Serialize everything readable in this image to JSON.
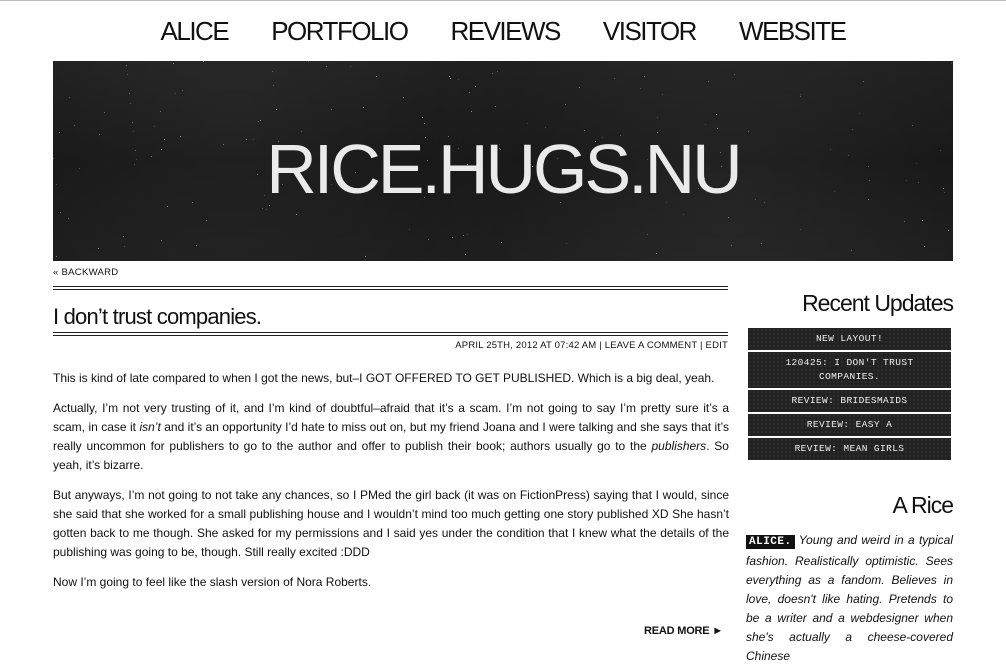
{
  "nav": {
    "items": [
      "ALICE",
      "PORTFOLIO",
      "REVIEWS",
      "VISITOR",
      "WEBSITE"
    ]
  },
  "banner": {
    "title": "RICE.HUGS.NU"
  },
  "backward_label": "« BACKWARD",
  "post": {
    "title": "I don’t trust companies.",
    "date": "APRIL 25TH, 2012 AT 07:42 AM",
    "comment_link": "LEAVE A COMMENT",
    "edit_link": "EDIT",
    "paragraphs": {
      "p1": "This is kind of late compared to when I got the news, but–I GOT OFFERED TO GET PUBLISHED. Which is a big deal, yeah.",
      "p2a": "Actually, I’m not very trusting of it, and I’m kind of doubtful–afraid that it’s a scam. I’m not going to say I’m pretty sure it’s a scam, in case it ",
      "p2b": "isn’t",
      "p2c": " and it’s an opportunity I’d hate to miss out on, but my friend Joana and I were talking and she says that it’s really uncommon for publishers to go to the author and offer to publish their book; authors usually go to the ",
      "p2d": "publishers",
      "p2e": ". So yeah, it’s bizarre.",
      "p3": "But anyways, I’m not going to not take any chances, so I PMed the girl back (it was on FictionPress) saying that I would, since she said that she worked for a small publishing house and I wouldn’t mind too much getting one story published XD She hasn’t gotten back to me though. She asked for my permissions and I said yes under the condition that I knew what the details of the publishing was going to be, though. Still really excited :DDD",
      "p4": "Now I’m going to feel like the slash version of Nora Roberts."
    },
    "read_more": "READ MORE ►"
  },
  "sidebar": {
    "recent_heading": "Recent Updates",
    "recent_items": [
      "NEW LAYOUT!",
      "120425: I DON'T TRUST COMPANIES.",
      "REVIEW: BRIDESMAIDS",
      "REVIEW: EASY A",
      "REVIEW: MEAN GIRLS"
    ],
    "about_heading": "A Rice",
    "about_name": "ALICE.",
    "about_text": " Young and weird in a typical fashion. Realistically optimistic. Sees everything as a fandom. Believes in love, doesn't like hating. Pretends to be a writer and a webdesigner when she's actually a cheese-covered Chinese"
  }
}
